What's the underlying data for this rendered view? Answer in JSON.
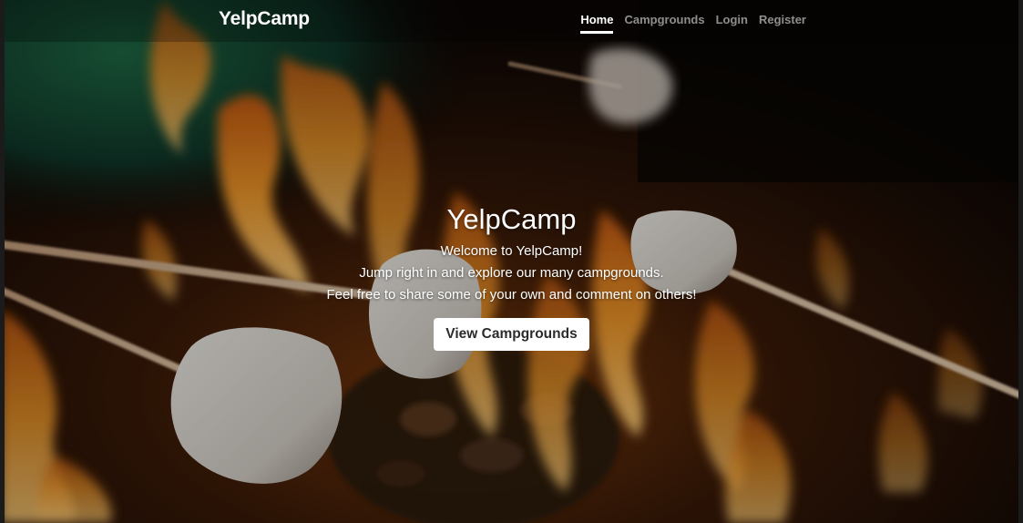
{
  "brand": "YelpCamp",
  "nav": {
    "items": [
      {
        "label": "Home",
        "active": true
      },
      {
        "label": "Campgrounds",
        "active": false
      },
      {
        "label": "Login",
        "active": false
      },
      {
        "label": "Register",
        "active": false
      }
    ]
  },
  "hero": {
    "title": "YelpCamp",
    "lines": [
      "Welcome to YelpCamp!",
      "Jump right in and explore our many campgrounds.",
      "Feel free to share some of your own and comment on others!"
    ],
    "button_label": "View Campgrounds"
  },
  "colors": {
    "nav_active": "#ffffff",
    "nav_inactive": "rgba(255,255,255,0.55)",
    "button_bg": "#ffffff",
    "button_text": "#2b2b2b"
  }
}
